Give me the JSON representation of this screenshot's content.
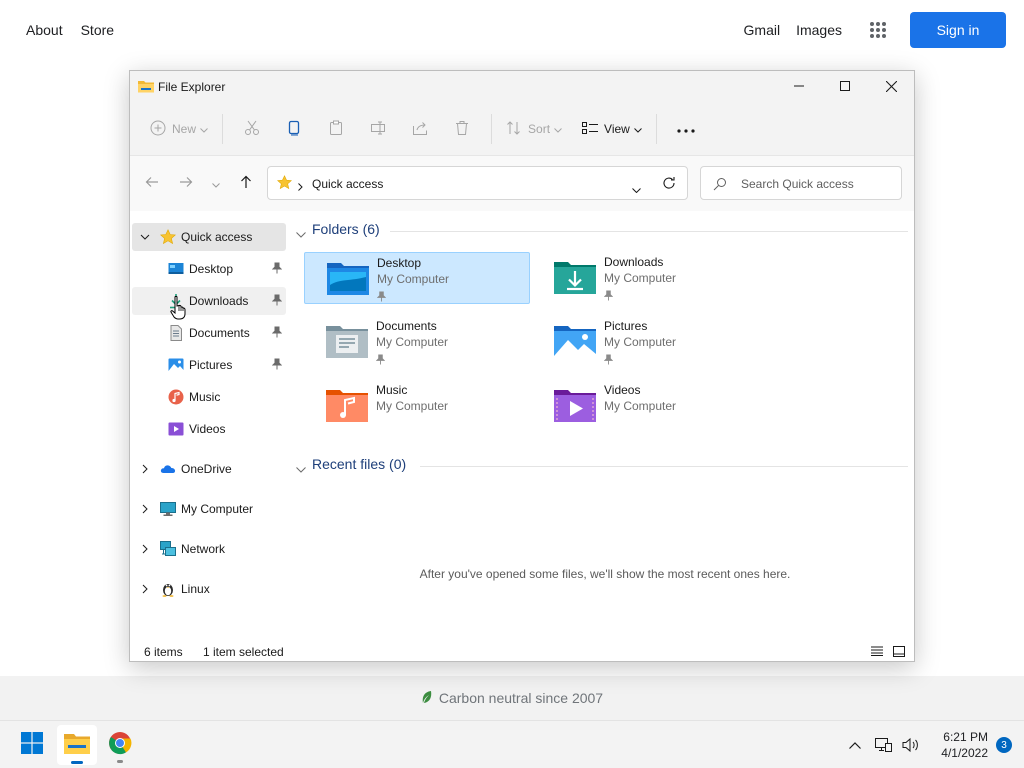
{
  "google": {
    "left_links": [
      "About",
      "Store"
    ],
    "right_links": [
      "Gmail",
      "Images"
    ],
    "signin_label": "Sign in",
    "footer_text": "Carbon neutral since 2007"
  },
  "explorer": {
    "title": "File Explorer",
    "toolbar": {
      "new_label": "New",
      "sort_label": "Sort",
      "view_label": "View"
    },
    "address": "Quick access",
    "search_placeholder": "Search Quick access",
    "sidebar": {
      "quick_access": "Quick access",
      "pinned": [
        {
          "label": "Desktop",
          "icon": "desktop-icon"
        },
        {
          "label": "Downloads",
          "icon": "downloads-icon"
        },
        {
          "label": "Documents",
          "icon": "documents-icon"
        },
        {
          "label": "Pictures",
          "icon": "pictures-icon"
        },
        {
          "label": "Music",
          "icon": "music-icon"
        },
        {
          "label": "Videos",
          "icon": "videos-icon"
        }
      ],
      "roots": [
        {
          "label": "OneDrive",
          "icon": "onedrive-icon"
        },
        {
          "label": "My Computer",
          "icon": "computer-icon"
        },
        {
          "label": "Network",
          "icon": "network-icon"
        },
        {
          "label": "Linux",
          "icon": "linux-icon"
        }
      ]
    },
    "folders_header": "Folders (6)",
    "folders": [
      {
        "name": "Desktop",
        "location": "My Computer",
        "pinned": true,
        "selected": true
      },
      {
        "name": "Downloads",
        "location": "My Computer",
        "pinned": true,
        "selected": false
      },
      {
        "name": "Documents",
        "location": "My Computer",
        "pinned": true,
        "selected": false
      },
      {
        "name": "Pictures",
        "location": "My Computer",
        "pinned": true,
        "selected": false
      },
      {
        "name": "Music",
        "location": "My Computer",
        "pinned": false,
        "selected": false
      },
      {
        "name": "Videos",
        "location": "My Computer",
        "pinned": false,
        "selected": false
      }
    ],
    "recent_header": "Recent files (0)",
    "recent_empty": "After you've opened some files, we'll show the most recent ones here.",
    "status_items": "6 items",
    "status_selected": "1 item selected"
  },
  "taskbar": {
    "time": "6:21 PM",
    "date": "4/1/2022",
    "notification_count": "3"
  },
  "colors": {
    "accent": "#0067c0",
    "signin": "#1a73e8",
    "selection": "#cce8ff",
    "group_header": "#1e3f7a"
  }
}
